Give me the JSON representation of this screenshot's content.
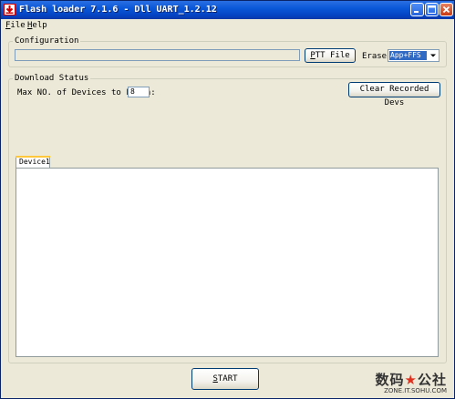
{
  "window": {
    "title": "Flash loader 7.1.6 - Dll UART_1.2.12"
  },
  "menu": {
    "file": {
      "accel": "F",
      "rest": "ile"
    },
    "help": {
      "accel": "H",
      "rest": "elp"
    }
  },
  "configuration": {
    "legend": "Configuration",
    "path_value": "",
    "ptt_button": {
      "accel": "P",
      "rest": "TT File"
    },
    "erase_label": "Erase:",
    "erase_value": "App+FFS"
  },
  "download": {
    "legend": "Download Status",
    "max_devices_label": "Max NO. of Devices to Flash:",
    "max_devices_value": "8",
    "clear_button": "Clear Recorded Devs",
    "tabs": [
      "Device1"
    ]
  },
  "start_button": {
    "accel": "S",
    "rest": "TART"
  },
  "watermark": {
    "main_a": "数码",
    "star": "★",
    "main_b": "公社",
    "sub": "ZONE.IT.SOHU.COM"
  },
  "colors": {
    "titlebar": "#0a58d8",
    "window_bg": "#ece9d8",
    "selection": "#316ac5",
    "close_button": "#c93b12"
  }
}
